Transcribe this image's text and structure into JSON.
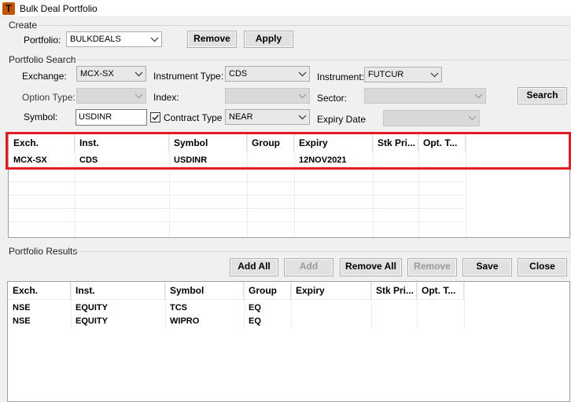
{
  "window": {
    "title": "Bulk Deal Portfolio"
  },
  "create": {
    "group_label": "Create",
    "portfolio_label": "Portfolio:",
    "portfolio_value": "BULKDEALS",
    "remove_label": "Remove",
    "apply_label": "Apply"
  },
  "search": {
    "group_label": "Portfolio Search",
    "exchange_label": "Exchange:",
    "exchange_value": "MCX-SX",
    "instrument_type_label": "Instrument Type:",
    "instrument_type_value": "CDS",
    "instrument_label": "Instrument:",
    "instrument_value": "FUTCUR",
    "option_type_label": "Option Type:",
    "index_label": "Index:",
    "sector_label": "Sector:",
    "search_button": "Search",
    "symbol_label": "Symbol:",
    "symbol_value": "USDINR",
    "contract_type_label": "Contract Type",
    "contract_type_checked": true,
    "contract_type_value": "NEAR",
    "expiry_date_label": "Expiry Date"
  },
  "search_grid": {
    "columns": [
      "Exch.",
      "Inst.",
      "Symbol",
      "Group",
      "Expiry",
      "Stk Pri...",
      "Opt. T..."
    ],
    "rows": [
      [
        "MCX-SX",
        "CDS",
        "USDINR",
        "",
        "12NOV2021",
        "",
        ""
      ]
    ]
  },
  "results": {
    "group_label": "Portfolio Results",
    "add_all": "Add All",
    "add": "Add",
    "remove_all": "Remove All",
    "remove": "Remove",
    "save": "Save",
    "close": "Close"
  },
  "results_grid": {
    "columns": [
      "Exch.",
      "Inst.",
      "Symbol",
      "Group",
      "Expiry",
      "Stk Pri...",
      "Opt. T..."
    ],
    "rows": [
      [
        "NSE",
        "EQUITY",
        "TCS",
        "EQ",
        "",
        "",
        ""
      ],
      [
        "NSE",
        "EQUITY",
        "WIPRO",
        "EQ",
        "",
        "",
        ""
      ]
    ]
  },
  "colors": {
    "highlight": "#e31b23",
    "icon": "#c25400"
  }
}
